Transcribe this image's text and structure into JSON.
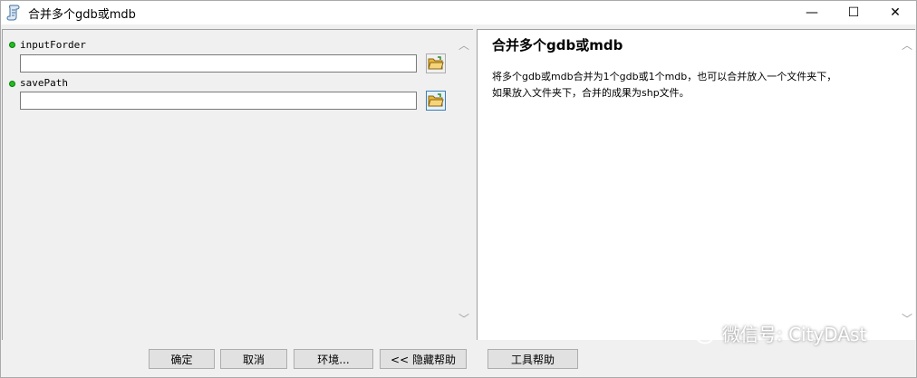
{
  "window": {
    "title": "合并多个gdb或mdb",
    "minimize_glyph": "—",
    "maximize_glyph": "☐",
    "close_glyph": "✕"
  },
  "params": [
    {
      "label": "inputForder",
      "value": ""
    },
    {
      "label": "savePath",
      "value": ""
    }
  ],
  "help": {
    "title": "合并多个gdb或mdb",
    "line1": "将多个gdb或mdb合并为1个gdb或1个mdb，也可以合并放入一个文件夹下，",
    "line2": "如果放入文件夹下，合并的成果为shp文件。"
  },
  "buttons": {
    "ok": "确定",
    "cancel": "取消",
    "environments": "环境...",
    "hide_help": "<< 隐藏帮助",
    "tool_help": "工具帮助"
  },
  "watermark": {
    "text": "微信号: CityDAst"
  },
  "colors": {
    "required_dot": "#1fbf1f",
    "folder_yellow": "#e8b83a"
  },
  "icons": {
    "app": "script-icon",
    "browse": "open-folder-icon",
    "watermark": "wechat-icon"
  }
}
